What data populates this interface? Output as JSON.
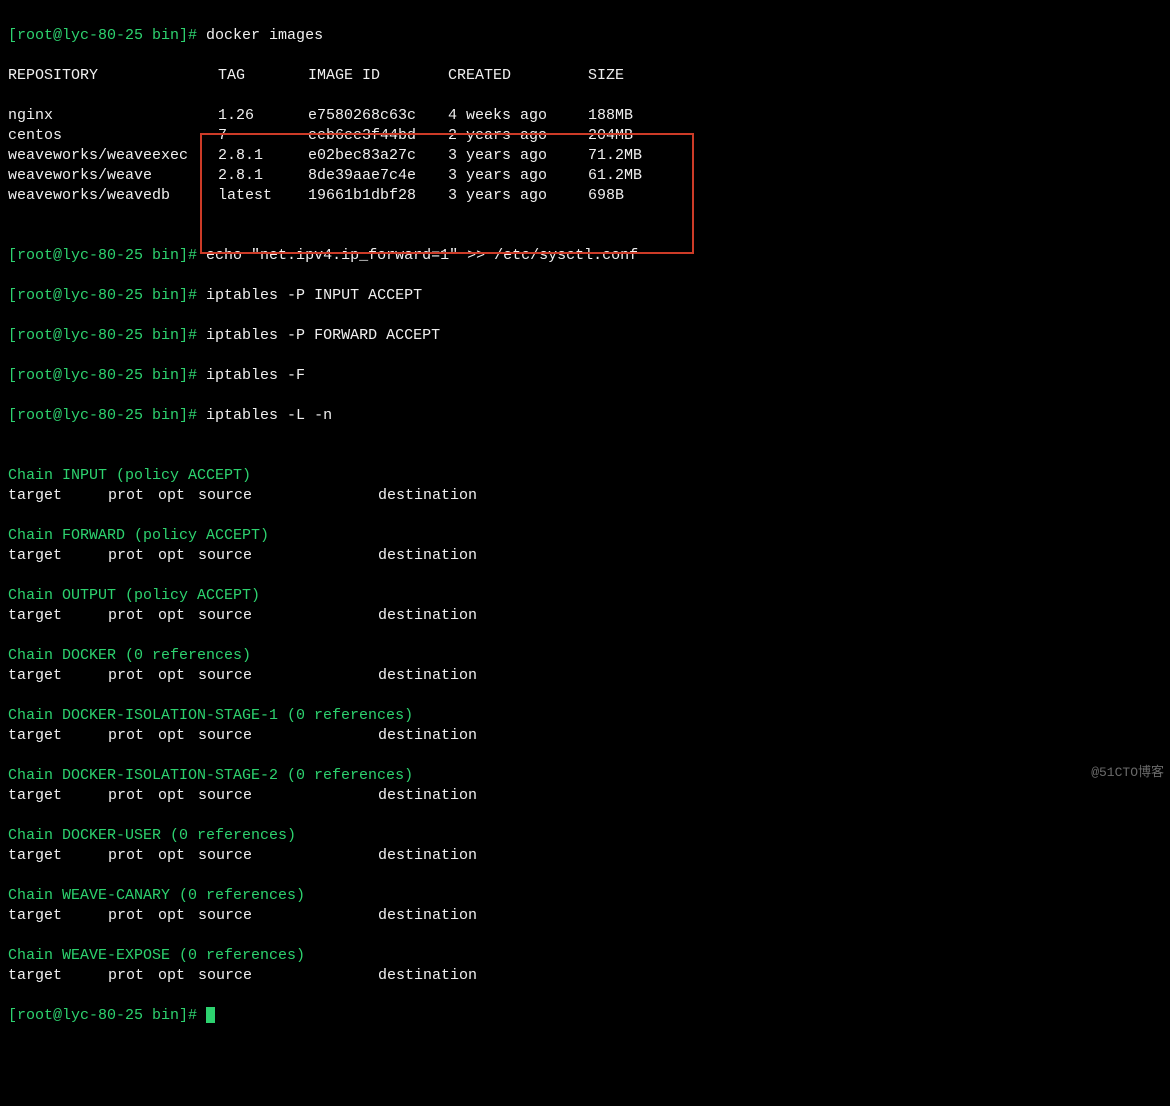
{
  "prompt": "[root@lyc-80-25 bin]#",
  "commands": {
    "docker_images": "docker images",
    "echo": "echo \"net.ipv4.ip_forward=1\" >> /etc/sysctl.conf",
    "ipt1": "iptables -P INPUT ACCEPT",
    "ipt2": "iptables -P FORWARD ACCEPT",
    "ipt3": "iptables -F",
    "ipt4": "iptables -L -n"
  },
  "docker_header": {
    "repo": "REPOSITORY",
    "tag": "TAG",
    "id": "IMAGE ID",
    "created": "CREATED",
    "size": "SIZE"
  },
  "docker_rows": [
    {
      "repo": "nginx",
      "tag": "1.26",
      "id": "e7580268c63c",
      "created": "4 weeks ago",
      "size": "188MB"
    },
    {
      "repo": "centos",
      "tag": "7",
      "id": "eeb6ee3f44bd",
      "created": "2 years ago",
      "size": "204MB"
    },
    {
      "repo": "weaveworks/weaveexec",
      "tag": "2.8.1",
      "id": "e02bec83a27c",
      "created": "3 years ago",
      "size": "71.2MB"
    },
    {
      "repo": "weaveworks/weave",
      "tag": "2.8.1",
      "id": "8de39aae7c4e",
      "created": "3 years ago",
      "size": "61.2MB"
    },
    {
      "repo": "weaveworks/weavedb",
      "tag": "latest",
      "id": "19661b1dbf28",
      "created": "3 years ago",
      "size": "698B"
    }
  ],
  "iptables_headers": {
    "target": "target",
    "prot": "prot",
    "opt": "opt",
    "source": "source",
    "dest": "destination"
  },
  "chains": [
    "Chain INPUT (policy ACCEPT)",
    "Chain FORWARD (policy ACCEPT)",
    "Chain OUTPUT (policy ACCEPT)",
    "Chain DOCKER (0 references)",
    "Chain DOCKER-ISOLATION-STAGE-1 (0 references)",
    "Chain DOCKER-ISOLATION-STAGE-2 (0 references)",
    "Chain DOCKER-USER (0 references)",
    "Chain WEAVE-CANARY (0 references)",
    "Chain WEAVE-EXPOSE (0 references)"
  ],
  "watermark": "@51CTO博客"
}
